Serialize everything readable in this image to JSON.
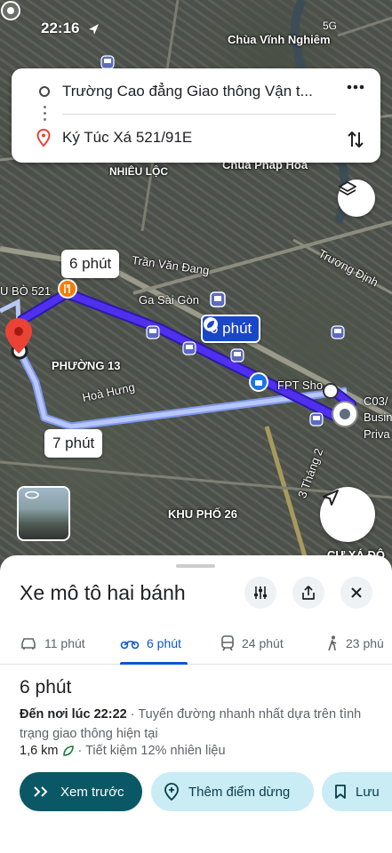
{
  "status": {
    "time": "22:16",
    "network": "5G"
  },
  "map": {
    "labels": {
      "pagoda": "Chùa Vĩnh Nghiêm",
      "district": "NHIÊU LỘC",
      "pagoda2": "Chùa Pháp Hoa",
      "tran_van_dang": "Trần Văn Đang",
      "truong_dinh": "Trương Định",
      "ga_sai_gon": "Ga Sài Gòn",
      "u_bo": "U BÒ 521",
      "phuong_13": "PHƯỜNG 13",
      "hoa_hung": "Hoà Hưng",
      "fpt_shop": "FPT Sho",
      "c03": "C03/",
      "busi": "Busin",
      "priva": "Priva",
      "ba_thang_hai": "3 Tháng 2",
      "khu_pho_26": "KHU PHỐ 26",
      "cu_xa_do": "CƯ XÁ ĐÔ"
    },
    "bubbles": {
      "top": "6 phút",
      "primary": "6 phút",
      "alt": "7 phút"
    }
  },
  "route": {
    "origin": "Trường Cao đẳng Giao thông Vận t...",
    "destination": "Ký Túc Xá 521/91E"
  },
  "sheet": {
    "mode_title": "Xe mô tô hai bánh",
    "tabs": [
      {
        "label": "11 phút",
        "icon": "car-icon"
      },
      {
        "label": "6 phút",
        "icon": "motorbike-icon"
      },
      {
        "label": "24 phút",
        "icon": "transit-icon"
      },
      {
        "label": "23 phú",
        "icon": "walk-icon"
      }
    ],
    "duration": "6 phút",
    "arrival_label": "Đến nơi lúc 22:22",
    "arrival_rest": " · Tuyến đường nhanh nhất dựa trên tình trạng giao thông hiện tại",
    "distance": "1,6 km",
    "fuel": " · Tiết kiệm 12% nhiên liệu",
    "actions": {
      "preview": "Xem trước",
      "add_stop": "Thêm điểm dừng",
      "save": "Lưu"
    }
  },
  "colors": {
    "route_primary": "#4a2fe0",
    "route_alt": "#9fb0f2",
    "primary_button": "#0a5865"
  }
}
